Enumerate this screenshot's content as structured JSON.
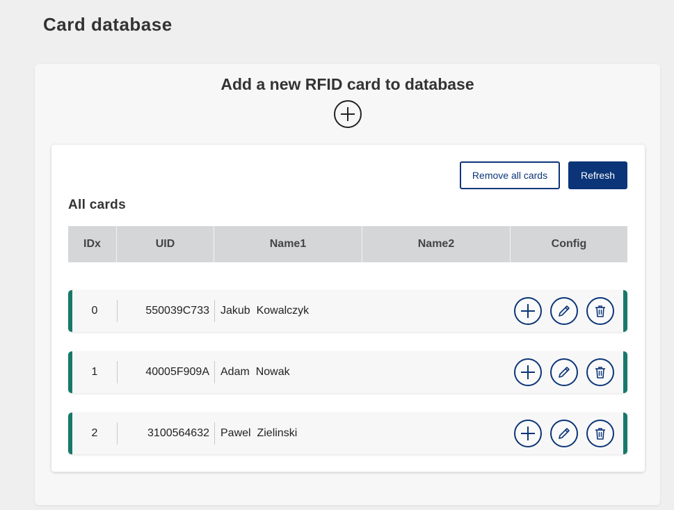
{
  "page": {
    "title": "Card database"
  },
  "add_section": {
    "title": "Add a new RFID card to database",
    "add_icon": "plus-circle-icon"
  },
  "toolbar": {
    "remove_all_label": "Remove all cards",
    "refresh_label": "Refresh"
  },
  "cards": {
    "section_title": "All cards",
    "columns": [
      "IDx",
      "UID",
      "Name1",
      "Name2",
      "Config"
    ],
    "rows": [
      {
        "idx": "0",
        "uid": "550039C733",
        "name": "Jakub  Kowalczyk"
      },
      {
        "idx": "1",
        "uid": "40005F909A",
        "name": "Adam  Nowak"
      },
      {
        "idx": "2",
        "uid": "3100564632",
        "name": "Pawel  Zielinski"
      }
    ],
    "row_actions": [
      "plus-icon",
      "pencil-icon",
      "trash-icon"
    ]
  },
  "colors": {
    "primary": "#0b3578",
    "row_accent": "#17786b",
    "header_bg": "#d5d6d8",
    "page_bg": "#efefef"
  }
}
